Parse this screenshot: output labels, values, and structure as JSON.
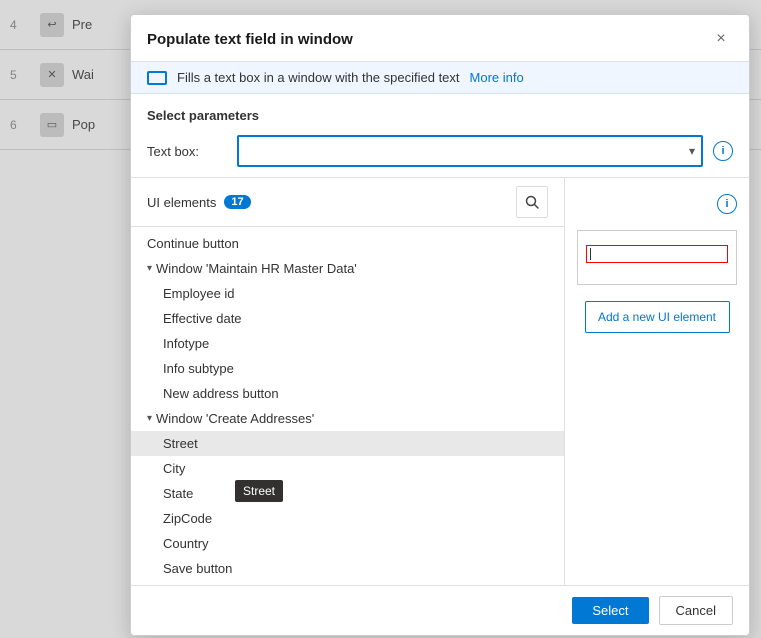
{
  "background": {
    "rows": [
      {
        "num": "4",
        "icon": "↩",
        "label": "Pre",
        "sublabel": "Pres"
      },
      {
        "num": "5",
        "icon": "✕",
        "label": "Wai",
        "sublabel": "Wai"
      },
      {
        "num": "6",
        "icon": "▭",
        "label": "Pop",
        "sublabel": "Pop"
      }
    ]
  },
  "modal": {
    "title": "Populate text field in window",
    "close_label": "×",
    "info_text": "Fills a text box in a window with the specified text",
    "info_link": "More info",
    "params_title": "Select parameters",
    "textbox_label": "Text box:",
    "textbox_placeholder": "",
    "info_icon_label": "i"
  },
  "ui_elements": {
    "label": "UI elements",
    "badge": "17",
    "search_icon": "🔍",
    "tree": [
      {
        "type": "item",
        "level": 1,
        "label": "Continue button",
        "selected": false
      },
      {
        "type": "group",
        "level": 1,
        "label": "Window 'Maintain HR Master Data'",
        "expanded": true
      },
      {
        "type": "item",
        "level": 2,
        "label": "Employee id",
        "selected": false
      },
      {
        "type": "item",
        "level": 2,
        "label": "Effective date",
        "selected": false
      },
      {
        "type": "item",
        "level": 2,
        "label": "Infotype",
        "selected": false
      },
      {
        "type": "item",
        "level": 2,
        "label": "Info subtype",
        "selected": false
      },
      {
        "type": "item",
        "level": 2,
        "label": "New address button",
        "selected": false
      },
      {
        "type": "group",
        "level": 1,
        "label": "Window 'Create Addresses'",
        "expanded": true
      },
      {
        "type": "item",
        "level": 2,
        "label": "Street",
        "selected": true
      },
      {
        "type": "item",
        "level": 2,
        "label": "City",
        "selected": false
      },
      {
        "type": "item",
        "level": 2,
        "label": "State",
        "selected": false
      },
      {
        "type": "item",
        "level": 2,
        "label": "ZipCode",
        "selected": false
      },
      {
        "type": "item",
        "level": 2,
        "label": "Country",
        "selected": false
      },
      {
        "type": "item",
        "level": 2,
        "label": "Save button",
        "selected": false
      }
    ]
  },
  "right_panel": {
    "add_ui_label": "Add a new UI element",
    "info_icon": "i"
  },
  "footer": {
    "select_label": "Select",
    "cancel_label": "Cancel"
  },
  "tooltip": {
    "text": "Street"
  }
}
